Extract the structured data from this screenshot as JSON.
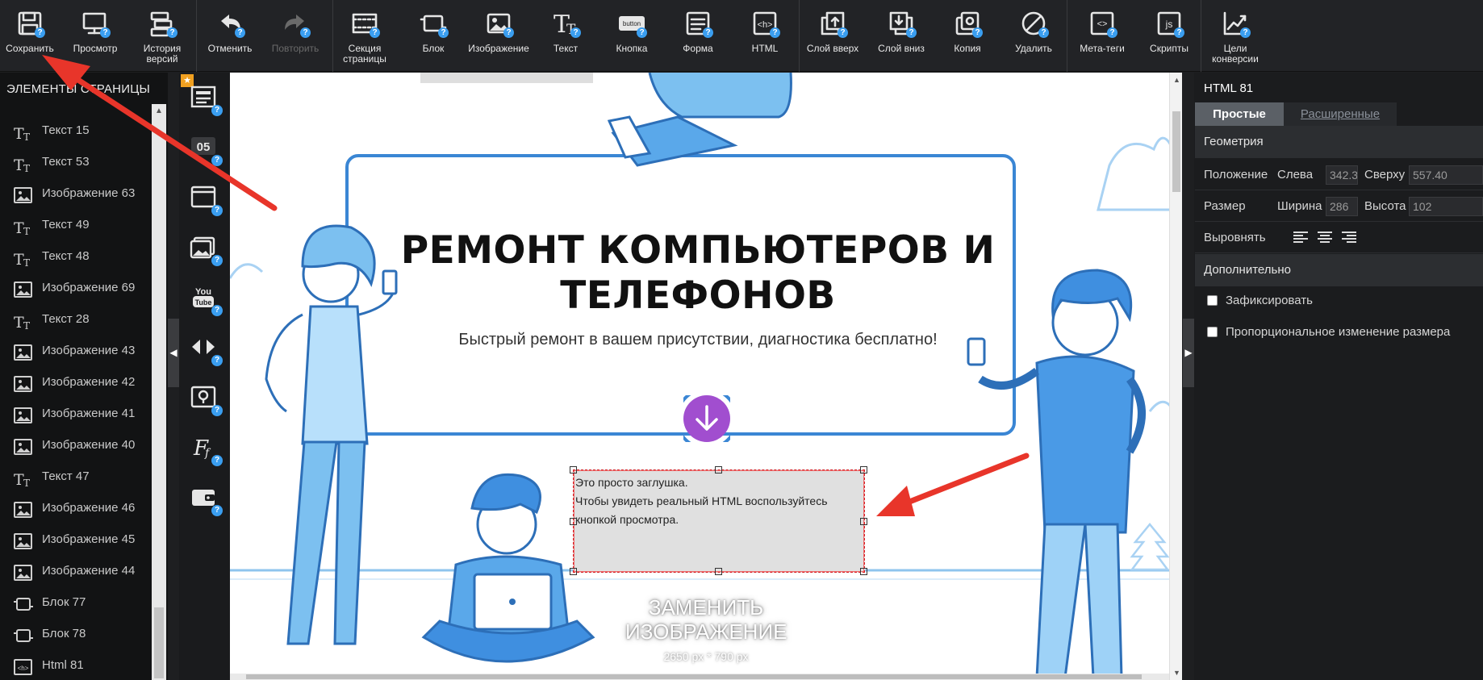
{
  "toolbar": {
    "items": [
      {
        "label": "Сохранить",
        "icon": "floppy-disk-icon"
      },
      {
        "label": "Просмотр",
        "icon": "monitor-icon"
      },
      {
        "label": "История версий",
        "icon": "history-icon"
      },
      {
        "label": "Отменить",
        "icon": "undo-icon"
      },
      {
        "label": "Повторить",
        "icon": "redo-icon",
        "disabled": true
      },
      {
        "label": "Секция страницы",
        "icon": "section-icon"
      },
      {
        "label": "Блок",
        "icon": "block-icon"
      },
      {
        "label": "Изображение",
        "icon": "image-icon"
      },
      {
        "label": "Текст",
        "icon": "text-icon"
      },
      {
        "label": "Кнопка",
        "icon": "button-icon",
        "inner": "button"
      },
      {
        "label": "Форма",
        "icon": "form-icon"
      },
      {
        "label": "HTML",
        "icon": "html-icon",
        "inner": "<h>"
      },
      {
        "label": "Слой вверх",
        "icon": "layer-up-icon"
      },
      {
        "label": "Слой вниз",
        "icon": "layer-down-icon"
      },
      {
        "label": "Копия",
        "icon": "copy-icon"
      },
      {
        "label": "Удалить",
        "icon": "delete-icon"
      },
      {
        "label": "Мета-теги",
        "icon": "meta-tags-icon",
        "inner": "<>"
      },
      {
        "label": "Скрипты",
        "icon": "scripts-icon",
        "inner": "js"
      },
      {
        "label": "Цели конверсии",
        "icon": "conversion-chart-icon"
      }
    ],
    "help_badge": "?"
  },
  "layers": {
    "title": "ЭЛЕМЕНТЫ СТРАНИЦЫ",
    "items": [
      {
        "label": "Текст 15",
        "type": "text"
      },
      {
        "label": "Текст 53",
        "type": "text"
      },
      {
        "label": "Изображение 63",
        "type": "image"
      },
      {
        "label": "Текст 49",
        "type": "text"
      },
      {
        "label": "Текст 48",
        "type": "text"
      },
      {
        "label": "Изображение 69",
        "type": "image"
      },
      {
        "label": "Текст 28",
        "type": "text"
      },
      {
        "label": "Изображение 43",
        "type": "image"
      },
      {
        "label": "Изображение 42",
        "type": "image"
      },
      {
        "label": "Изображение 41",
        "type": "image"
      },
      {
        "label": "Изображение 40",
        "type": "image"
      },
      {
        "label": "Текст 47",
        "type": "text"
      },
      {
        "label": "Изображение 46",
        "type": "image"
      },
      {
        "label": "Изображение 45",
        "type": "image"
      },
      {
        "label": "Изображение 44",
        "type": "image"
      },
      {
        "label": "Блок 77",
        "type": "block"
      },
      {
        "label": "Блок 78",
        "type": "block"
      },
      {
        "label": "Html 81",
        "type": "html"
      }
    ]
  },
  "widgets": {
    "items": [
      "news-widget-icon",
      "countdown-widget-icon",
      "popup-widget-icon",
      "gallery-widget-icon",
      "youtube-widget-icon",
      "slider-widget-icon",
      "map-widget-icon",
      "font-widget-icon",
      "wallet-widget-icon"
    ],
    "countdown_text": "05",
    "youtube_text": "You Tube",
    "star": "★"
  },
  "canvas": {
    "title": "РЕМОНТ КОМПЬЮТЕРОВ И ТЕЛЕФОНОВ",
    "subtitle": "Быстрый ремонт в вашем присутствии, диагностика бесплатно!",
    "placeholder_lines": [
      "Это просто заглушка.",
      "Чтобы увидеть реальный HTML воспользуйтесь",
      "кнопкой просмотра."
    ],
    "replace_image": "ЗАМЕНИТЬ ИЗОБРАЖЕНИЕ",
    "image_size": "2650 px * 790 px",
    "accent_color": "#a14ecf",
    "illustration_color": "#3a86d4"
  },
  "properties": {
    "title": "HTML 81",
    "tabs": [
      "Простые",
      "Расширенные"
    ],
    "geometry_title": "Геометрия",
    "position_label": "Положение",
    "left_label": "Слева",
    "left_value": "342.3",
    "top_label": "Сверху",
    "top_value": "557.40",
    "size_label": "Размер",
    "width_label": "Ширина",
    "width_value": "286",
    "height_label": "Высота",
    "height_value": "102",
    "align_label": "Выровнять",
    "extra_title": "Дополнительно",
    "fix_label": "Зафиксировать",
    "proportional_label": "Пропорциональное изменение размера"
  }
}
